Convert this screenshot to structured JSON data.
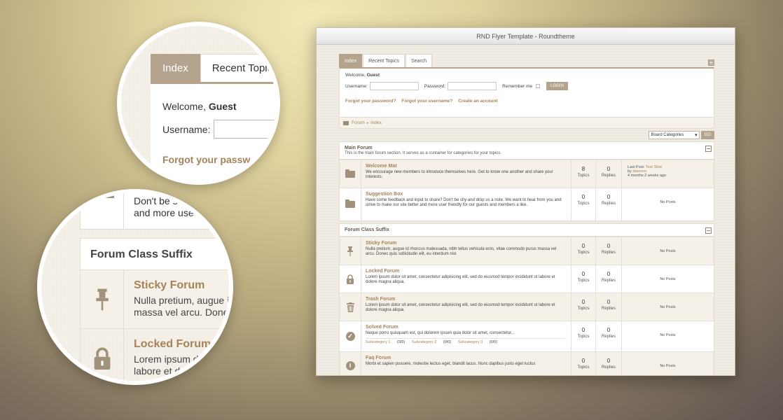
{
  "window_title": "RND Flyer Template - Roundtheme",
  "tabs": [
    {
      "label": "Index",
      "active": true
    },
    {
      "label": "Recent Topics",
      "active": false
    },
    {
      "label": "Search",
      "active": false
    }
  ],
  "login": {
    "welcome_prefix": "Welcome,",
    "guest": "Guest",
    "username_label": "Username:",
    "password_label": "Password:",
    "remember_label": "Remember me",
    "login_button": "LOGIN",
    "links": [
      "Forgot your password?",
      "Forgot your username?",
      "Create an account"
    ]
  },
  "breadcrumb": {
    "items": [
      "Forum",
      "index"
    ]
  },
  "jump": {
    "select_value": "Board Categories",
    "go_button": "GO"
  },
  "labels": {
    "topics": "Topics",
    "replies": "Replies",
    "no_posts": "No Posts"
  },
  "categories": [
    {
      "title": "Main Forum",
      "description": "This is the main forum section. It serves as a container for categories for your topics.",
      "forums": [
        {
          "title": "Welcome Mat",
          "description": "We encourage new members to introduce themselves here. Get to know one another and share your interests.",
          "topics": "8",
          "replies": "0",
          "last_post": {
            "prefix": "Last Post:",
            "title": "Test Slive",
            "by_prefix": "by",
            "author": "daemon",
            "time": "4 months 2 weeks ago"
          },
          "icon": "folder-icon"
        },
        {
          "title": "Suggestion Box",
          "description": "Have some feedback and input to share? Don't be shy and drop us a note. We want to hear from you and strive to make our site better and more user friendly for our guests and members a like.",
          "topics": "0",
          "replies": "0",
          "icon": "folder-icon"
        }
      ]
    },
    {
      "title": "Forum Class Suffix",
      "forums": [
        {
          "title": "Sticky Forum",
          "description": "Nulla pretium, augue id rhoncus malesuada, nibh tellus vehicula eros, vitae commodo purus massa vel arcu. Donec quis sollicitudin elit, eu interdum nisl",
          "topics": "0",
          "replies": "0",
          "icon": "pin-icon"
        },
        {
          "title": "Locked Forum",
          "description": "Lorem ipsum dolor sit amet, consectetur adipisicing elit, sed do eiusmod tempor incididunt ut labore et dolore magna aliqua.",
          "topics": "0",
          "replies": "0",
          "icon": "lock-icon"
        },
        {
          "title": "Trash Forum",
          "description": "Lorem ipsum dolor sit amet, consectetur adipisicing elit, sed do eiusmod tempor incididunt ut labore et dolore magna aliqua.",
          "topics": "0",
          "replies": "0",
          "icon": "trash-icon"
        },
        {
          "title": "Solved Forum",
          "description": "Neque porro quisquam est, qui dolorem ipsum quia dolor sit amet, consectetur...",
          "topics": "0",
          "replies": "0",
          "icon": "check-icon",
          "subcategories": [
            {
              "name": "Subcategory 1",
              "count": "(0/0)"
            },
            {
              "name": "Subcategory 2",
              "count": "(0/0)"
            },
            {
              "name": "Subcategory 3",
              "count": "(0/0)"
            }
          ]
        },
        {
          "title": "Faq Forum",
          "description": "Morbi et sapien posuere, molestie lectus eget, blandit lacus. Nunc dapibus justo eget luctus",
          "topics": "0",
          "replies": "0",
          "icon": "info-icon"
        }
      ]
    }
  ],
  "zoom1": {
    "tabs": [
      "Index",
      "Recent Topic"
    ],
    "welcome_prefix": "Welcome,",
    "guest": "Guest",
    "username_label": "Username:",
    "forgot": "Forgot your passw"
  },
  "zoom2": {
    "top_text_line1": "Don't be s",
    "top_text_line2": "and more use",
    "category_title": "Forum Class Suffix",
    "rows": [
      {
        "title": "Sticky Forum",
        "line1": "Nulla pretium, augue i",
        "line2": "massa vel arcu. Done"
      },
      {
        "title": "Locked Forum",
        "line1": "Lorem ipsum do",
        "line2": "labore et dolo"
      }
    ]
  },
  "colors": {
    "accent": "#b4a48d",
    "link": "#a5835a",
    "icon": "#a1927e"
  }
}
